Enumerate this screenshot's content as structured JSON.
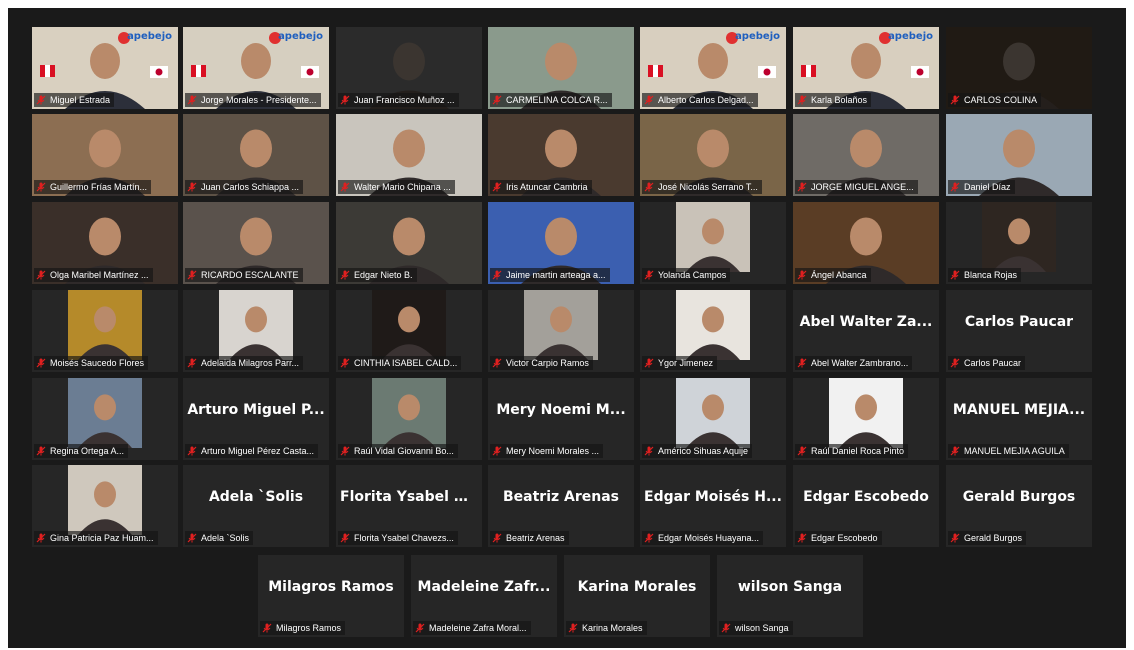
{
  "participants": [
    {
      "label": "Miguel Estrada",
      "bg": "#d9d0c0",
      "style": "flag",
      "brand": "apebejo"
    },
    {
      "label": "Jorge Morales - Presidente...",
      "bg": "#d6cfc0",
      "style": "flag",
      "brand": "apebejo",
      "active": true
    },
    {
      "label": "Juan Francisco Muñoz ...",
      "bg": "#2b2b2b",
      "style": "dark"
    },
    {
      "label": "CARMELINA COLCA R...",
      "bg": "#8a9a8c",
      "style": "cam"
    },
    {
      "label": "Alberto Carlos Delgad...",
      "bg": "#d8cfbf",
      "style": "flag",
      "brand": "apebejo"
    },
    {
      "label": "Karla Bolaños",
      "bg": "#d8cfbf",
      "style": "flag",
      "brand": "apebejo"
    },
    {
      "label": "CARLOS COLINA",
      "bg": "#201a14",
      "style": "dark"
    },
    {
      "label": "Guillermo Frías Martín...",
      "bg": "#8c6e52",
      "style": "cam"
    },
    {
      "label": "Juan Carlos Schiappa ...",
      "bg": "#5e5246",
      "style": "cam"
    },
    {
      "label": "Walter Mario Chipana ...",
      "bg": "#c9c5bd",
      "style": "cam"
    },
    {
      "label": "Iris Atuncar Cambria",
      "bg": "#4a3a2f",
      "style": "cam"
    },
    {
      "label": "José Nicolás Serrano T...",
      "bg": "#7a6548",
      "style": "cam"
    },
    {
      "label": "JORGE MIGUEL ANGE...",
      "bg": "#6f6b66",
      "style": "cam"
    },
    {
      "label": "Daniel Díaz",
      "bg": "#9aa8b4",
      "style": "cam"
    },
    {
      "label": "Olga Maribel Martínez ...",
      "bg": "#3a2f29",
      "style": "cam"
    },
    {
      "label": "RICARDO ESCALANTE",
      "bg": "#5a524c",
      "style": "cam"
    },
    {
      "label": "Edgar Nieto B.",
      "bg": "#3c3a36",
      "style": "cam"
    },
    {
      "label": "Jaime martin arteaga a...",
      "bg": "#3b5fb0",
      "style": "cam"
    },
    {
      "label": "Yolanda Campos",
      "bg": "#c9c2b8",
      "style": "small"
    },
    {
      "label": "Ángel Abanca",
      "bg": "#5a3d25",
      "style": "cam"
    },
    {
      "label": "Blanca Rojas",
      "bg": "#2e2621",
      "style": "small"
    },
    {
      "label": "Moisés Saucedo Flores",
      "bg": "#b58a2a",
      "style": "small"
    },
    {
      "label": "Adelaida Milagros Parr...",
      "bg": "#d8d4cf",
      "style": "small"
    },
    {
      "label": "CINTHIA ISABEL CALD...",
      "bg": "#1f1a18",
      "style": "small"
    },
    {
      "label": "Victor Carpio Ramos",
      "bg": "#a3a09a",
      "style": "small"
    },
    {
      "label": "Ygor Jimenez",
      "bg": "#e8e4de",
      "style": "small"
    },
    {
      "label": "Abel Walter Zambrano...",
      "big": "Abel Walter Za...",
      "style": "blank"
    },
    {
      "label": "Carlos Paucar",
      "big": "Carlos Paucar",
      "style": "blank"
    },
    {
      "label": "Regina Ortega A...",
      "bg": "#6b7d93",
      "style": "small"
    },
    {
      "label": "Arturo Miguel Pérez Casta...",
      "big": "Arturo Miguel P...",
      "style": "blank"
    },
    {
      "label": "Raúl Vidal Giovanni Bo...",
      "bg": "#6b7a72",
      "style": "small"
    },
    {
      "label": "Mery Noemi Morales ...",
      "big": "Mery Noemi M...",
      "style": "blank"
    },
    {
      "label": "Américo Sihuas Aquije",
      "bg": "#cfd3d8",
      "style": "small"
    },
    {
      "label": "Raúl Daniel Roca Pinto",
      "bg": "#f1f1f1",
      "style": "small"
    },
    {
      "label": "MANUEL MEJIA AGUILA",
      "big": "MANUEL  MEJIA...",
      "style": "blank"
    },
    {
      "label": "Gina Patricia Paz Huam...",
      "bg": "#cfc8bd",
      "style": "small"
    },
    {
      "label": "Adela `Solis",
      "big": "Adela `Solis",
      "style": "blank"
    },
    {
      "label": "Florita Ysabel Chavezs...",
      "big": "Florita Ysabel C...",
      "style": "blank"
    },
    {
      "label": "Beatriz Arenas",
      "big": "Beatriz Arenas",
      "style": "blank"
    },
    {
      "label": "Edgar Moisés Huayana...",
      "big": "Edgar Moisés H...",
      "style": "blank"
    },
    {
      "label": "Edgar Escobedo",
      "big": "Edgar Escobedo",
      "style": "blank"
    },
    {
      "label": "Gerald Burgos",
      "big": "Gerald Burgos",
      "style": "blank"
    },
    {
      "label": "Milagros Ramos",
      "big": "Milagros Ramos",
      "style": "blank"
    },
    {
      "label": "Madeleine Zafra Moral...",
      "big": "Madeleine  Zafr...",
      "style": "blank"
    },
    {
      "label": "Karina Morales",
      "big": "Karina Morales",
      "style": "blank"
    },
    {
      "label": "wilson Sanga",
      "big": "wilson Sanga",
      "style": "blank"
    }
  ],
  "icons": {
    "mic": "mic-muted-icon"
  },
  "colors": {
    "background": "#1a1a1a",
    "tile": "#262626",
    "active_border": "#c8d46a",
    "mute": "#e02020"
  }
}
